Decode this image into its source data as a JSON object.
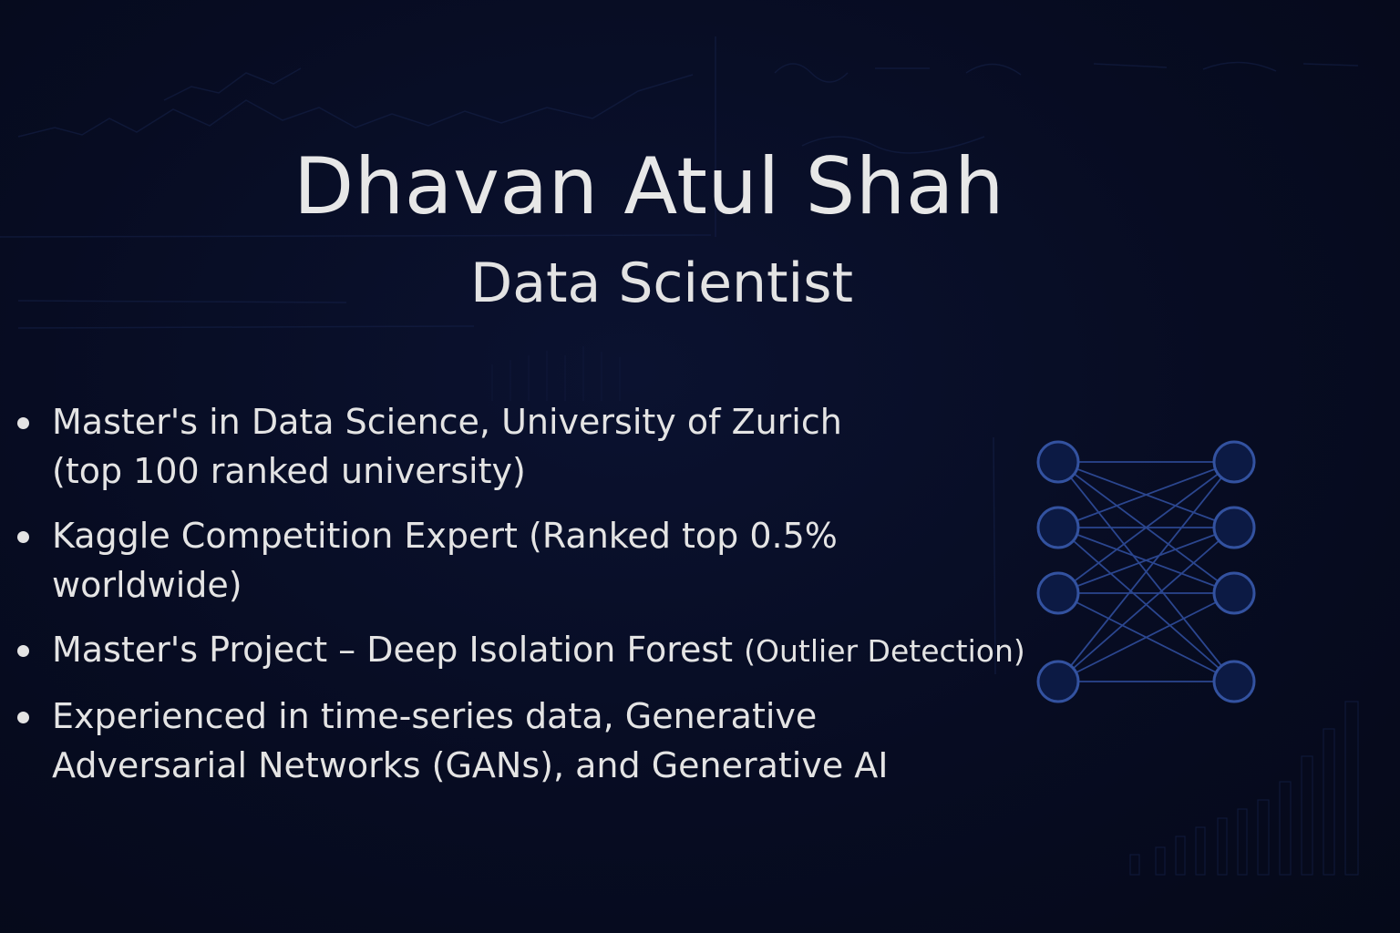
{
  "slide": {
    "name": "Dhavan Atul Shah",
    "role": "Data Scientist"
  },
  "bullets": [
    {
      "line1": "Master's in Data Science, University of Zurich",
      "line2": "(top 100 ranked university)"
    },
    {
      "line1": "Kaggle Competition Expert (Ranked top 0.5%",
      "line2": "worldwide)"
    },
    {
      "main": "Master's Project – Deep Isolation Forest ",
      "small": "(Outlier Detection)"
    },
    {
      "line1": "Experienced in time-series data, Generative",
      "line2": "Adversarial Networks (GANs), and Generative AI"
    }
  ],
  "colors": {
    "background": "#070c22",
    "text": "#e4e4e4",
    "network_line": "#2b468f",
    "node_fill": "#0c1a44",
    "node_stroke": "#3352a0"
  },
  "graphic": {
    "type": "neural-network-icon",
    "left_nodes": 4,
    "right_nodes": 4
  }
}
